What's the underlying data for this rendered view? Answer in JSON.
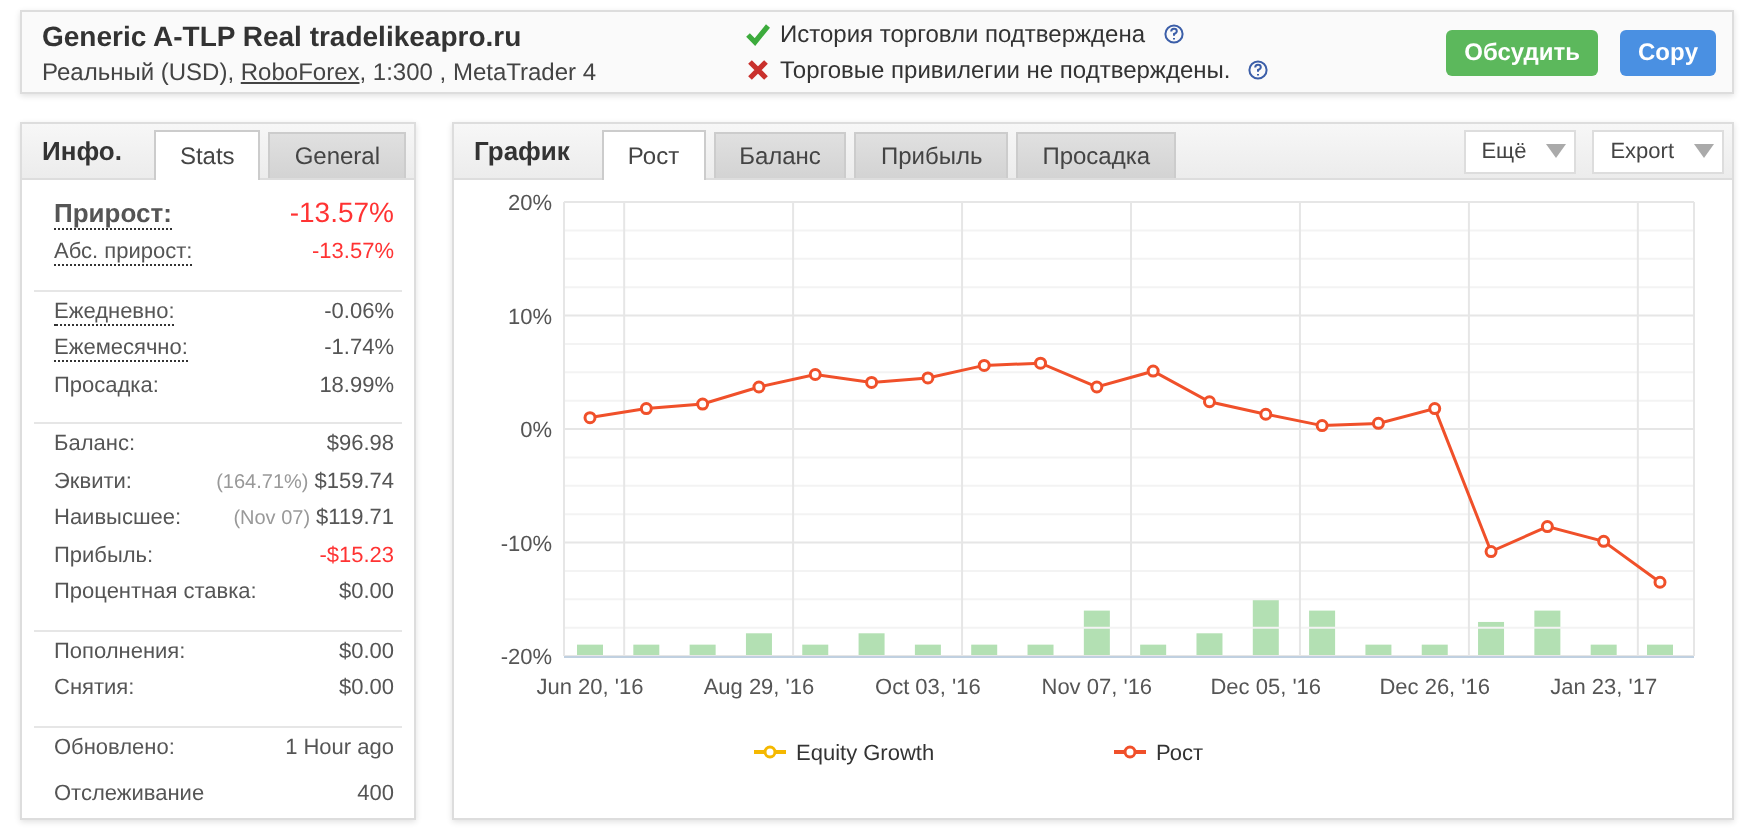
{
  "header": {
    "title": "Generic A-TLP Real tradelikeapro.ru",
    "subtitle_before": "Реальный (USD), ",
    "broker_link": "RoboForex",
    "subtitle_after": ", 1:300 , MetaTrader 4",
    "statuses": [
      {
        "text": "История торговли подтверждена",
        "verified": true
      },
      {
        "text": "Торговые привилегии не подтверждены.",
        "verified": false
      }
    ],
    "buttons": [
      {
        "label": "Обсудить",
        "color": "#5cb85c"
      },
      {
        "label": "Copy",
        "color": "#4a90e2"
      }
    ]
  },
  "info": {
    "heading": "Инфо.",
    "tabs": [
      {
        "label": "Stats",
        "selected": true
      },
      {
        "label": "General",
        "selected": false
      }
    ],
    "groups": [
      {
        "rows": [
          {
            "label": "Прирост:",
            "value": "-13.57%",
            "kind": "headline",
            "dotted": true,
            "negative": true
          },
          {
            "label": "Абс. прирост:",
            "value": "-13.57%",
            "kind": "plain",
            "dotted": true,
            "negative": true
          }
        ]
      },
      {
        "rows": [
          {
            "label": "Ежедневно:",
            "value": "-0.06%",
            "kind": "plain",
            "dotted": true,
            "negative": false
          },
          {
            "label": "Ежемесячно:",
            "value": "-1.74%",
            "kind": "plain",
            "dotted": true,
            "negative": false
          },
          {
            "label": "Просадка:",
            "value": "18.99%",
            "kind": "plain",
            "dotted": false,
            "negative": false
          }
        ]
      },
      {
        "rows": [
          {
            "label": "Баланс:",
            "value": "$96.98",
            "kind": "plain",
            "dotted": false,
            "negative": false
          },
          {
            "label": "Эквити:",
            "note": "(164.71%)",
            "value": "$159.74",
            "kind": "plain",
            "dotted": false,
            "negative": false
          },
          {
            "label": "Наивысшее:",
            "note": "(Nov 07)",
            "value": "$119.71",
            "kind": "plain",
            "dotted": false,
            "negative": false
          },
          {
            "label": "Прибыль:",
            "value": "-$15.23",
            "kind": "plain",
            "dotted": false,
            "negative": true
          },
          {
            "label": "Процентная ставка:",
            "value": "$0.00",
            "kind": "plain",
            "dotted": false,
            "negative": false
          }
        ]
      },
      {
        "rows": [
          {
            "label": "Пополнения:",
            "value": "$0.00",
            "kind": "plain",
            "dotted": false,
            "negative": false
          },
          {
            "label": "Снятия:",
            "value": "$0.00",
            "kind": "plain",
            "dotted": false,
            "negative": false
          }
        ]
      },
      {
        "rows": [
          {
            "label": "Обновлено:",
            "value": "1 Hour ago",
            "kind": "plain",
            "dotted": false,
            "negative": false
          },
          {
            "label": "Отслеживание",
            "value": "400",
            "kind": "plain",
            "dotted": false,
            "negative": false
          }
        ]
      }
    ]
  },
  "chart_panel": {
    "heading": "График",
    "tabs": [
      {
        "label": "Рост",
        "selected": true
      },
      {
        "label": "Баланс",
        "selected": false
      },
      {
        "label": "Прибыль",
        "selected": false
      },
      {
        "label": "Просадка",
        "selected": false
      }
    ],
    "menus": [
      {
        "label": "Ещё"
      },
      {
        "label": "Export"
      }
    ],
    "chart_data": {
      "type": "line",
      "categories": [
        "Jun 20, '16",
        null,
        null,
        "Aug 29, '16",
        null,
        null,
        "Oct 03, '16",
        null,
        null,
        "Nov 07, '16",
        null,
        null,
        "Dec 05, '16",
        null,
        null,
        "Dec 26, '16",
        null,
        null,
        "Jan 23, '17",
        null
      ],
      "ylim": [
        -20,
        20
      ],
      "grid": true,
      "yticks": [
        {
          "value": -20,
          "label": "-20%"
        },
        {
          "value": -10,
          "label": "-10%"
        },
        {
          "value": 0,
          "label": "0%"
        },
        {
          "value": 10,
          "label": "10%"
        },
        {
          "value": 20,
          "label": "20%"
        }
      ],
      "series": [
        {
          "name": "Equity Growth",
          "color": "#f5b800",
          "marker": "circle",
          "values": [
            null,
            null,
            null,
            null,
            null,
            null,
            null,
            null,
            null,
            null,
            null,
            null,
            null,
            null,
            null,
            null,
            null,
            null,
            null,
            null
          ]
        },
        {
          "name": "Рост",
          "color": "#f0502a",
          "marker": "circle",
          "values": [
            1.0,
            1.8,
            2.2,
            3.7,
            4.8,
            4.1,
            4.5,
            5.6,
            5.8,
            3.7,
            5.1,
            2.4,
            1.3,
            0.3,
            0.5,
            1.8,
            -10.8,
            -8.6,
            -9.9,
            -13.5
          ]
        }
      ]
    }
  }
}
